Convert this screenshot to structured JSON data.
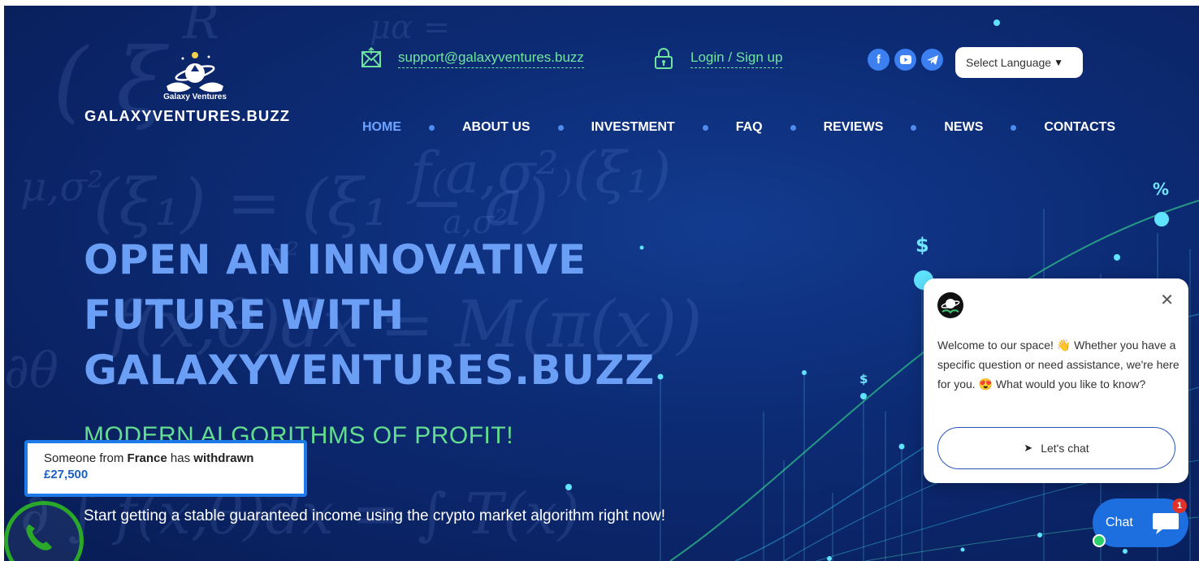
{
  "brand": {
    "logo_small_text": "Galaxy Ventures",
    "logo_big_text": "GALAXYVENTURES.BUZZ"
  },
  "header": {
    "email": "support@galaxyventures.buzz",
    "login": "Login / Sign up",
    "social": {
      "facebook": "f",
      "youtube_icon": "youtube-icon",
      "telegram_icon": "telegram-icon"
    },
    "language_select": "Select Language",
    "language_caret": "▼"
  },
  "nav": {
    "items": [
      {
        "label": "HOME",
        "active": true
      },
      {
        "label": "ABOUT US"
      },
      {
        "label": "INVESTMENT"
      },
      {
        "label": "FAQ"
      },
      {
        "label": "REVIEWS"
      },
      {
        "label": "NEWS"
      },
      {
        "label": "CONTACTS"
      }
    ]
  },
  "hero": {
    "headline_line1": "OPEN AN INNOVATIVE",
    "headline_line2": "FUTURE WITH",
    "headline_line3": "GALAXYVENTURES.BUZZ",
    "subhead": "MODERN ALGORITHMS OF PROFIT!",
    "body": "Start getting a stable guaranteed income using the crypto market algorithm right now!"
  },
  "toast": {
    "prefix": "Someone from ",
    "country": "France",
    "middle": " has ",
    "action": "withdrawn",
    "amount": "£27,500"
  },
  "chat_popup": {
    "close": "✕",
    "message": "Welcome to our space! 👋 Whether you have a specific question or need assistance, we're here for you. 😍 What would you like to know?",
    "button_arrow": "➤",
    "button_label": "Let's chat"
  },
  "chat_launcher": {
    "label": "Chat",
    "badge": "1"
  },
  "colors": {
    "accent_green": "#6fe5a0",
    "headline_blue": "#6b9ef5",
    "chat_blue": "#1d6fe0"
  }
}
